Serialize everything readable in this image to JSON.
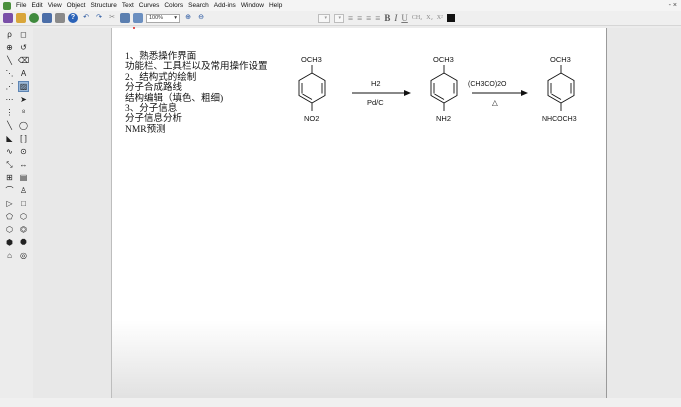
{
  "menu": [
    "File",
    "Edit",
    "View",
    "Object",
    "Structure",
    "Text",
    "Curves",
    "Colors",
    "Search",
    "Add-ins",
    "Window",
    "Help"
  ],
  "window_controls": "- ×",
  "toolbar": {
    "zoom": "100%",
    "format_buttons": {
      "bold": "B",
      "italic": "I",
      "underline": "U",
      "formula": "CH₂",
      "subscript": "X₂",
      "superscript": "X²"
    }
  },
  "palette_selected": "orbital-tool",
  "notes": [
    "1、熟悉操作界面",
    "功能栏、工具栏以及常用操作设置",
    "2、结构式的绘制",
    "分子合成路线",
    "结构编辑（填色、粗细)",
    "3、分子信息",
    "分子信息分析",
    "NMR预测"
  ],
  "reaction": {
    "compound1": {
      "top": "OCH3",
      "bottom": "NO2"
    },
    "step1": {
      "above": "H2",
      "below": "Pd/C"
    },
    "compound2": {
      "top": "OCH3",
      "bottom": "NH2"
    },
    "step2": {
      "above": "(CH3CO)2O",
      "below": "△"
    },
    "compound3": {
      "top": "OCH3",
      "bottom": "NHCOCH3"
    }
  },
  "colors": {
    "page": "#ffffff",
    "canvas": "#e8e8e8",
    "selection": "#9cb9d9",
    "accent_dot": "#dd2222"
  }
}
